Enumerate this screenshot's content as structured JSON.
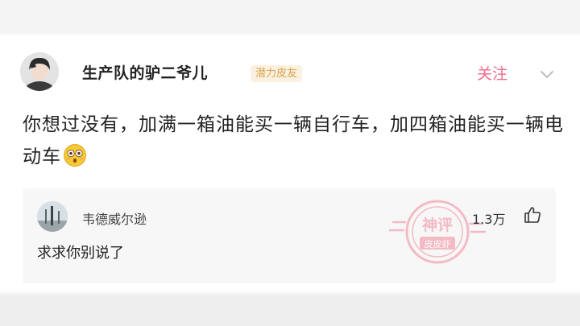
{
  "post": {
    "username": "生产队的驴二爷儿",
    "badge": "潜力皮友",
    "follow_label": "关注",
    "text": "你想过没有，加满一箱油能买一辆自行车，加四箱油能买一辆电动车",
    "emoji_icon": "flushed-face-icon"
  },
  "comment": {
    "username": "韦德威尔逊",
    "text": "求求你别说了",
    "likes": "1.3万",
    "like_icon": "thumbs-up-icon",
    "stamp_text": [
      "神评",
      "皮皮虾"
    ]
  },
  "colors": {
    "accent": "#f06a8a",
    "badge_bg": "#fbf1e0",
    "badge_text": "#d8a24c",
    "stamp": "#f08a9a"
  }
}
